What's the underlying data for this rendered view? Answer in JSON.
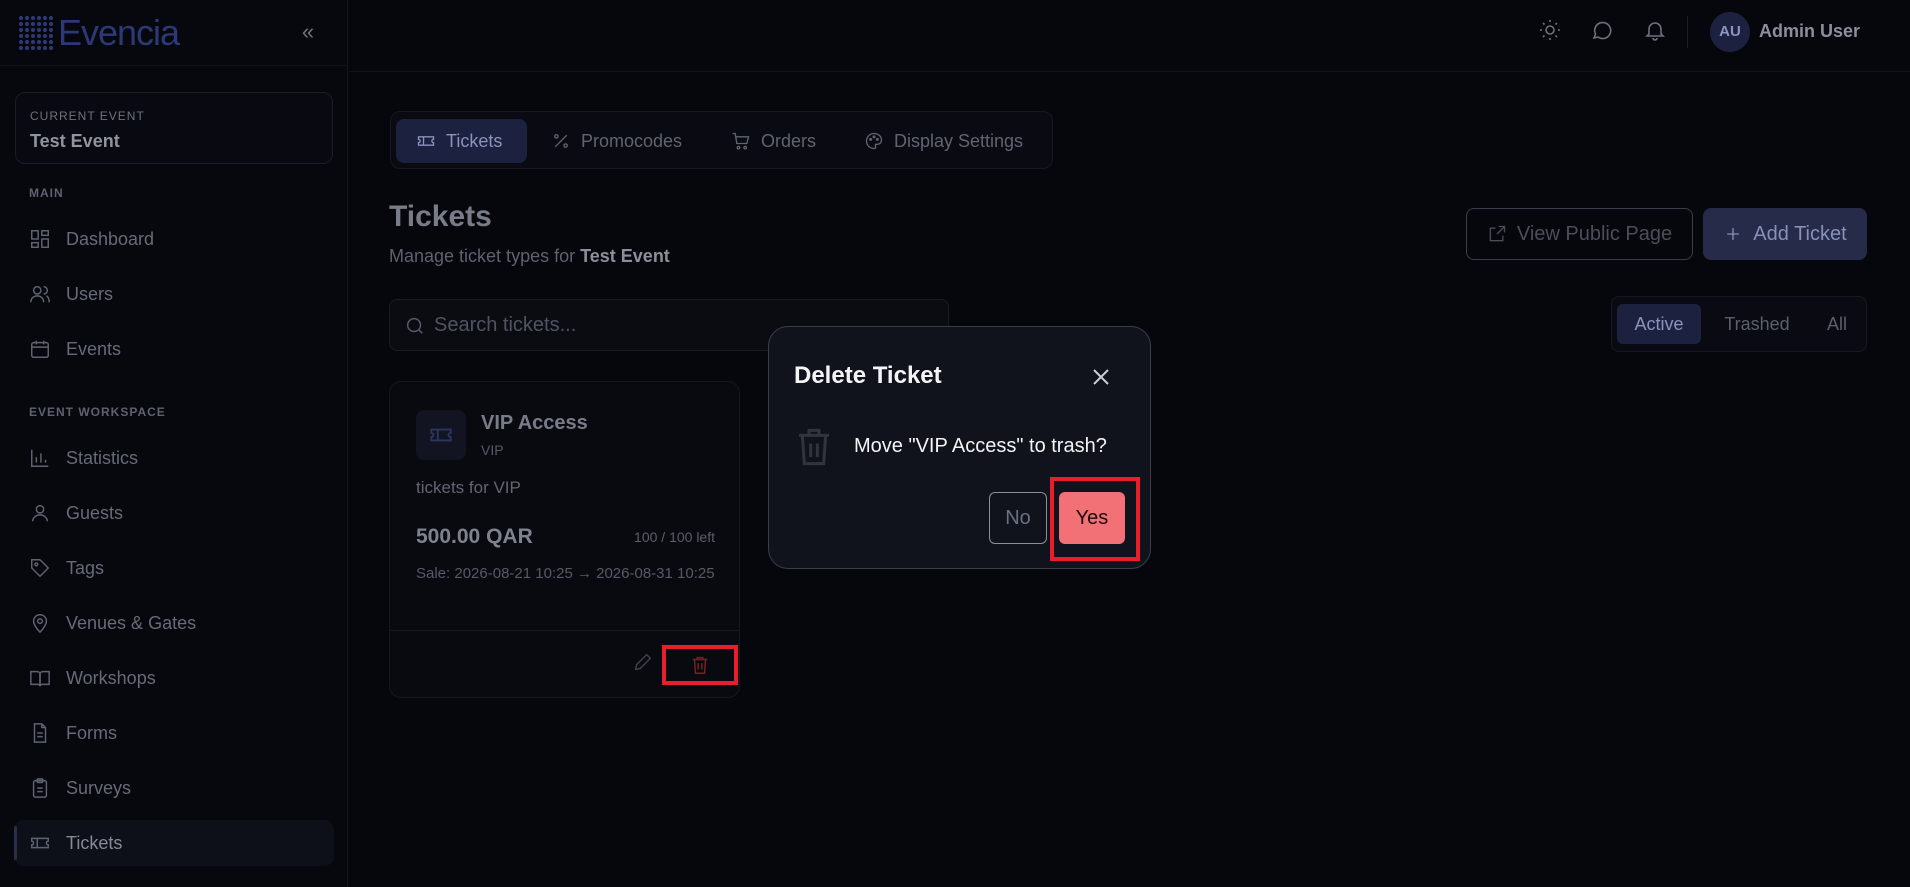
{
  "brand": {
    "name": "Evencia"
  },
  "sidebar": {
    "current_event_label": "CURRENT EVENT",
    "current_event_name": "Test Event",
    "main_label": "MAIN",
    "workspace_label": "EVENT WORKSPACE",
    "main_items": [
      {
        "label": "Dashboard",
        "icon": "dashboard-icon"
      },
      {
        "label": "Users",
        "icon": "users-icon"
      },
      {
        "label": "Events",
        "icon": "calendar-icon"
      }
    ],
    "workspace_items": [
      {
        "label": "Statistics",
        "icon": "bar-chart-icon"
      },
      {
        "label": "Guests",
        "icon": "user-icon"
      },
      {
        "label": "Tags",
        "icon": "tag-icon"
      },
      {
        "label": "Venues & Gates",
        "icon": "map-pin-icon"
      },
      {
        "label": "Workshops",
        "icon": "book-icon"
      },
      {
        "label": "Forms",
        "icon": "file-text-icon"
      },
      {
        "label": "Surveys",
        "icon": "clipboard-icon"
      },
      {
        "label": "Tickets",
        "icon": "ticket-icon",
        "active": true
      }
    ]
  },
  "topbar": {
    "user_initials": "AU",
    "user_name": "Admin User"
  },
  "tabs": [
    {
      "label": "Tickets",
      "active": true
    },
    {
      "label": "Promocodes"
    },
    {
      "label": "Orders"
    },
    {
      "label": "Display Settings"
    }
  ],
  "header": {
    "title": "Tickets",
    "subtitle_prefix": "Manage ticket types for",
    "subtitle_event": "Test Event",
    "view_public_label": "View Public Page",
    "add_ticket_label": "Add Ticket"
  },
  "search": {
    "placeholder": "Search tickets..."
  },
  "filters": [
    {
      "label": "Active",
      "active": true
    },
    {
      "label": "Trashed"
    },
    {
      "label": "All"
    }
  ],
  "ticket": {
    "name": "VIP Access",
    "code": "VIP",
    "description": "tickets for VIP",
    "price": "500.00 QAR",
    "availability": "100 / 100 left",
    "sale": "Sale: 2026-08-21 10:25 → 2026-08-31 10:25"
  },
  "dialog": {
    "title": "Delete Ticket",
    "message": "Move \"VIP Access\" to trash?",
    "no_label": "No",
    "yes_label": "Yes"
  },
  "colors": {
    "accent": "#1c2140",
    "danger": "#f27176",
    "highlight": "#ea1e2b"
  }
}
